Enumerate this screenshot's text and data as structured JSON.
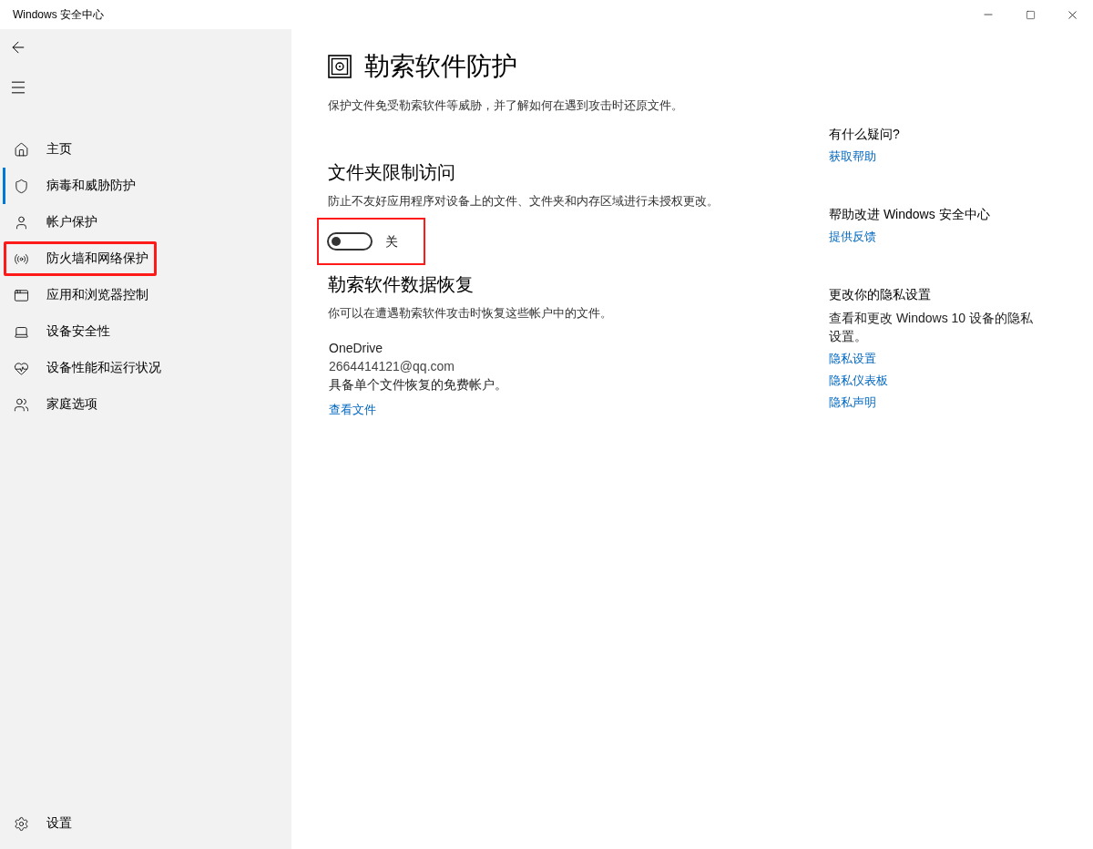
{
  "window": {
    "title": "Windows 安全中心"
  },
  "sidebar": {
    "items": [
      {
        "label": "主页",
        "selected": false,
        "highlighted": false
      },
      {
        "label": "病毒和威胁防护",
        "selected": true,
        "highlighted": false
      },
      {
        "label": "帐户保护",
        "selected": false,
        "highlighted": false
      },
      {
        "label": "防火墙和网络保护",
        "selected": false,
        "highlighted": true
      },
      {
        "label": "应用和浏览器控制",
        "selected": false,
        "highlighted": false
      },
      {
        "label": "设备安全性",
        "selected": false,
        "highlighted": false
      },
      {
        "label": "设备性能和运行状况",
        "selected": false,
        "highlighted": false
      },
      {
        "label": "家庭选项",
        "selected": false,
        "highlighted": false
      }
    ],
    "settings": {
      "label": "设置"
    }
  },
  "page": {
    "title": "勒索软件防护",
    "description": "保护文件免受勒索软件等威胁，并了解如何在遇到攻击时还原文件。",
    "sections": [
      {
        "heading": "文件夹限制访问",
        "description": "防止不友好应用程序对设备上的文件、文件夹和内存区域进行未授权更改。",
        "toggle": {
          "on": false,
          "label": "关",
          "highlighted": true
        }
      },
      {
        "heading": "勒索软件数据恢复",
        "description": "你可以在遭遇勒索软件攻击时恢复这些帐户中的文件。",
        "account": {
          "provider": "OneDrive",
          "email": "2664414121@qq.com",
          "plan": "具备单个文件恢复的免费帐户。",
          "link": "查看文件"
        }
      }
    ]
  },
  "aside": [
    {
      "heading": "有什么疑问?",
      "links": [
        "获取帮助"
      ]
    },
    {
      "heading": "帮助改进 Windows 安全中心",
      "links": [
        "提供反馈"
      ]
    },
    {
      "heading": "更改你的隐私设置",
      "text": "查看和更改 Windows 10 设备的隐私设置。",
      "links": [
        "隐私设置",
        "隐私仪表板",
        "隐私声明"
      ]
    }
  ]
}
